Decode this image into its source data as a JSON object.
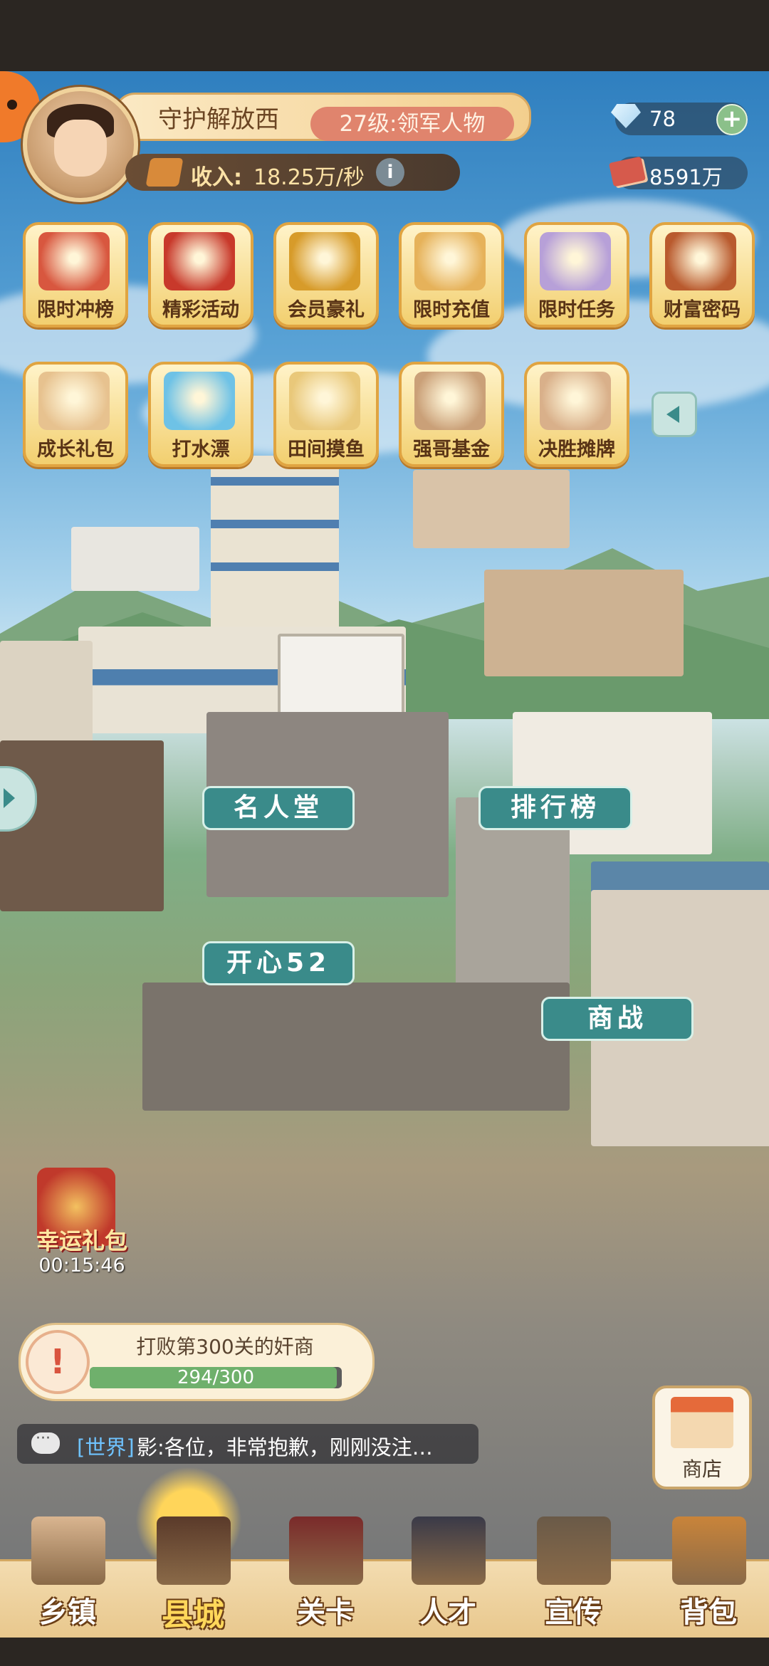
{
  "player": {
    "name": "守护解放西",
    "level_badge": "27级:领军人物",
    "income_label": "收入:",
    "income_value": "18.25万/秒",
    "info_icon": "i"
  },
  "resources": {
    "gems": "78",
    "add": "+",
    "cash": "8591万"
  },
  "events_row1": [
    {
      "label": "限时冲榜",
      "icon": "trophy-clock-icon",
      "color": "#d8573f"
    },
    {
      "label": "精彩活动",
      "icon": "gift-box-icon",
      "color": "#c8392b"
    },
    {
      "label": "会员豪礼",
      "icon": "vip-badge-icon",
      "color": "#d79b2a"
    },
    {
      "label": "限时充值",
      "icon": "piggy-bank-icon",
      "color": "#e6b25a"
    },
    {
      "label": "限时任务",
      "icon": "task-scroll-icon",
      "color": "#b7a0d8"
    },
    {
      "label": "财富密码",
      "icon": "wallet-key-icon",
      "color": "#b95a2e"
    }
  ],
  "events_row2": [
    {
      "label": "成长礼包",
      "icon": "girl-portrait-icon",
      "color": "#e7c28f"
    },
    {
      "label": "打水漂",
      "icon": "water-splash-icon",
      "color": "#6ec2e6"
    },
    {
      "label": "田间摸鱼",
      "icon": "straw-hat-icon",
      "color": "#e9c87a"
    },
    {
      "label": "强哥基金",
      "icon": "man-portrait-icon",
      "color": "#caa078"
    },
    {
      "label": "决胜摊牌",
      "icon": "woman-cards-icon",
      "color": "#d9b08a"
    }
  ],
  "map_labels": {
    "hall_of_fame": "名人堂",
    "leaderboard": "排行榜",
    "happy52": "开心52",
    "business_war": "商战"
  },
  "lucky_gift": {
    "label": "幸运礼包",
    "timer": "00:15:46"
  },
  "task": {
    "text": "打败第300关的奸商",
    "progress_text": "294/300",
    "progress": 0.98
  },
  "chat": {
    "channel": "[世界]",
    "message": "影:各位，非常抱歉，刚刚没注…"
  },
  "shop": {
    "label": "商店"
  },
  "nav": [
    {
      "label": "乡镇",
      "icon": "village-house-icon",
      "active": false
    },
    {
      "label": "县城",
      "icon": "tv-sun-icon",
      "active": true
    },
    {
      "label": "关卡",
      "icon": "sewing-machine-icon",
      "active": false
    },
    {
      "label": "人才",
      "icon": "businessman-icon",
      "active": false
    },
    {
      "label": "宣传",
      "icon": "film-camera-icon",
      "active": false
    },
    {
      "label": "背包",
      "icon": "briefcase-icon",
      "active": false
    }
  ]
}
